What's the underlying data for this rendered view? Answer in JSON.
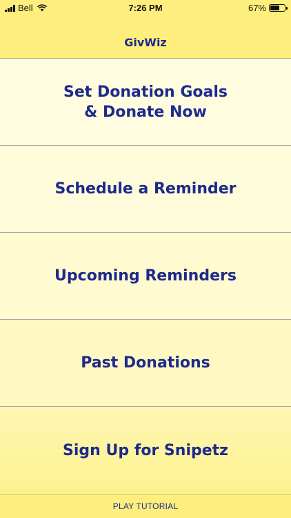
{
  "status_bar": {
    "carrier": "Bell",
    "time": "7:26 PM",
    "battery_percent": "67%",
    "battery_level": 0.67,
    "icons": [
      "signal-icon",
      "wifi-icon",
      "battery-icon"
    ]
  },
  "nav": {
    "title": "GivWiz"
  },
  "menu": {
    "items": [
      {
        "line1": "Set Donation Goals",
        "line2": "& Donate Now"
      },
      {
        "line1": "Schedule a Reminder"
      },
      {
        "line1": "Upcoming Reminders"
      },
      {
        "line1": "Past Donations"
      },
      {
        "line1": "Sign Up for Snipetz"
      }
    ]
  },
  "footer": {
    "label": "PLAY TUTORIAL"
  },
  "colors": {
    "accent_text": "#1d2a8c",
    "bar_yellow": "#fdee7d",
    "cell_light": "#fffce0"
  }
}
